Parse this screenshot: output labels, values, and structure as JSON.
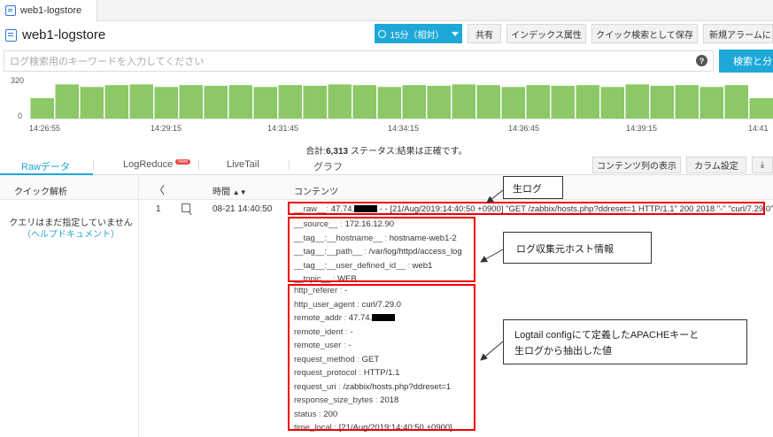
{
  "tab": {
    "label": "web1-logstore"
  },
  "header": {
    "title": "web1-logstore",
    "time_button": "15分（相対）",
    "share": "共有",
    "index_attr": "インデックス属性",
    "save_quick": "クイック検索として保存",
    "new_alarm": "新規アラームにし"
  },
  "search": {
    "placeholder": "ログ検索用のキーワードを入力してください",
    "help": "?",
    "button": "検索と分"
  },
  "histogram": {
    "ymax": "320",
    "ymin": "0",
    "xticks": [
      "14:26:55",
      "14:29:15",
      "14:31:45",
      "14:34:15",
      "14:36:45",
      "14:39:15",
      "14:41"
    ],
    "bar_heights": [
      0.55,
      0.92,
      0.85,
      0.9,
      0.92,
      0.85,
      0.9,
      0.88,
      0.9,
      0.85,
      0.9,
      0.88,
      0.92,
      0.9,
      0.85,
      0.9,
      0.88,
      0.92,
      0.9,
      0.85,
      0.9,
      0.88,
      0.9,
      0.85,
      0.92,
      0.88,
      0.9,
      0.85,
      0.9,
      0.55
    ]
  },
  "summary": {
    "prefix": "合計:",
    "total": "6,313",
    "suffix": " ステータス:結果は正確です。"
  },
  "subtabs": {
    "raw": "Rawデータ",
    "logreduce": "LogReduce",
    "badge": "new",
    "livetail": "LiveTail",
    "graph": "グラフ"
  },
  "actions": {
    "content_cols": "コンテンツ列の表示",
    "column_settings": "カラム設定"
  },
  "table": {
    "quick_analysis": "クイック解析",
    "chevron": "〈",
    "time_header": "時間",
    "content_header": "コンテンツ",
    "empty_hint": "クエリはまだ指定していません",
    "help_link": "（ヘルプドキュメント）",
    "row_index": "1",
    "row_time": "08-21 14:40:50"
  },
  "raw_line": {
    "key": "__raw__",
    "value_prefix": "47.74.",
    "value_suffix": " - - [21/Aug/2019:14:40:50 +0900] \"GET /zabbix/hosts.php?ddreset=1 HTTP/1.1\" 200 2018 \"-\" \"curl/7.29.0\""
  },
  "meta_fields": [
    {
      "key": "__source__",
      "value": "172.16.12.90"
    },
    {
      "key": "__tag__:__hostname__",
      "value": "hostname-web1-2"
    },
    {
      "key": "__tag__:__path__",
      "value": "/var/log/httpd/access_log"
    },
    {
      "key": "__tag__:__user_defined_id__",
      "value": "web1"
    },
    {
      "key": "__topic__",
      "value": "WEB"
    }
  ],
  "apache_fields": [
    {
      "key": "http_referer",
      "value": "-"
    },
    {
      "key": "http_user_agent",
      "value": "curl/7.29.0"
    },
    {
      "key": "remote_addr",
      "value": "47.74."
    },
    {
      "key": "remote_ident",
      "value": "-"
    },
    {
      "key": "remote_user",
      "value": "-"
    },
    {
      "key": "request_method",
      "value": "GET"
    },
    {
      "key": "request_protocol",
      "value": "HTTP/1.1"
    },
    {
      "key": "request_uri",
      "value": "/zabbix/hosts.php?ddreset=1"
    },
    {
      "key": "response_size_bytes",
      "value": "2018"
    },
    {
      "key": "status",
      "value": "200"
    },
    {
      "key": "time_local",
      "value": "[21/Aug/2019:14:40:50 +0900]"
    }
  ],
  "callouts": {
    "raw": "生ログ",
    "host": "ログ収集元ホスト情報",
    "apache_line1": "Logtail configにて定義したAPACHEキーと",
    "apache_line2": "生ログから抽出した値"
  },
  "colors": {
    "accent": "#1ea8d8",
    "bar": "#8cc865",
    "highlight": "#e00000"
  }
}
